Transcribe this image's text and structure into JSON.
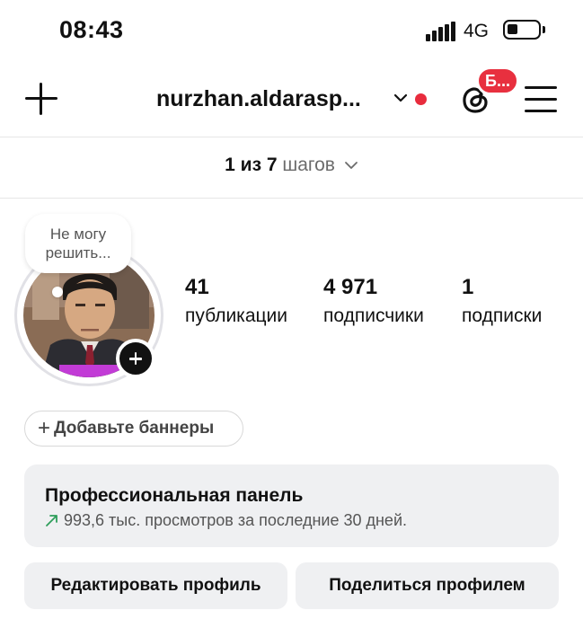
{
  "status_bar": {
    "time": "08:43",
    "network": "4G",
    "icons": [
      "signal-icon",
      "battery-icon"
    ]
  },
  "header": {
    "username": "nurzhan.aldarasp...",
    "threads_badge": "Б...",
    "icons": [
      "plus-icon",
      "chevron-down-icon",
      "threads-icon",
      "menu-icon"
    ],
    "notification_dot_color": "#e82c3d"
  },
  "steps": {
    "progress": "1 из 7",
    "label": "шагов",
    "current_step": 1,
    "total_steps": 7
  },
  "profile": {
    "thought_bubble": [
      "Не могу",
      "решить..."
    ],
    "stats": [
      {
        "value": "41",
        "label": "публикации"
      },
      {
        "value": "4 971",
        "label": "подписчики"
      },
      {
        "value": "1",
        "label": "подписки"
      }
    ]
  },
  "banners": {
    "label": "Добавьте баннеры"
  },
  "professional_panel": {
    "title": "Профессиональная панель",
    "subtitle": "993,6 тыс. просмотров за последние 30 дней.",
    "trend_color": "#2e9e5b"
  },
  "actions": {
    "edit_profile": "Редактировать профиль",
    "share_profile": "Поделиться профилем"
  },
  "colors": {
    "accent_red": "#e8303f",
    "card_bg": "#eff0f2"
  }
}
